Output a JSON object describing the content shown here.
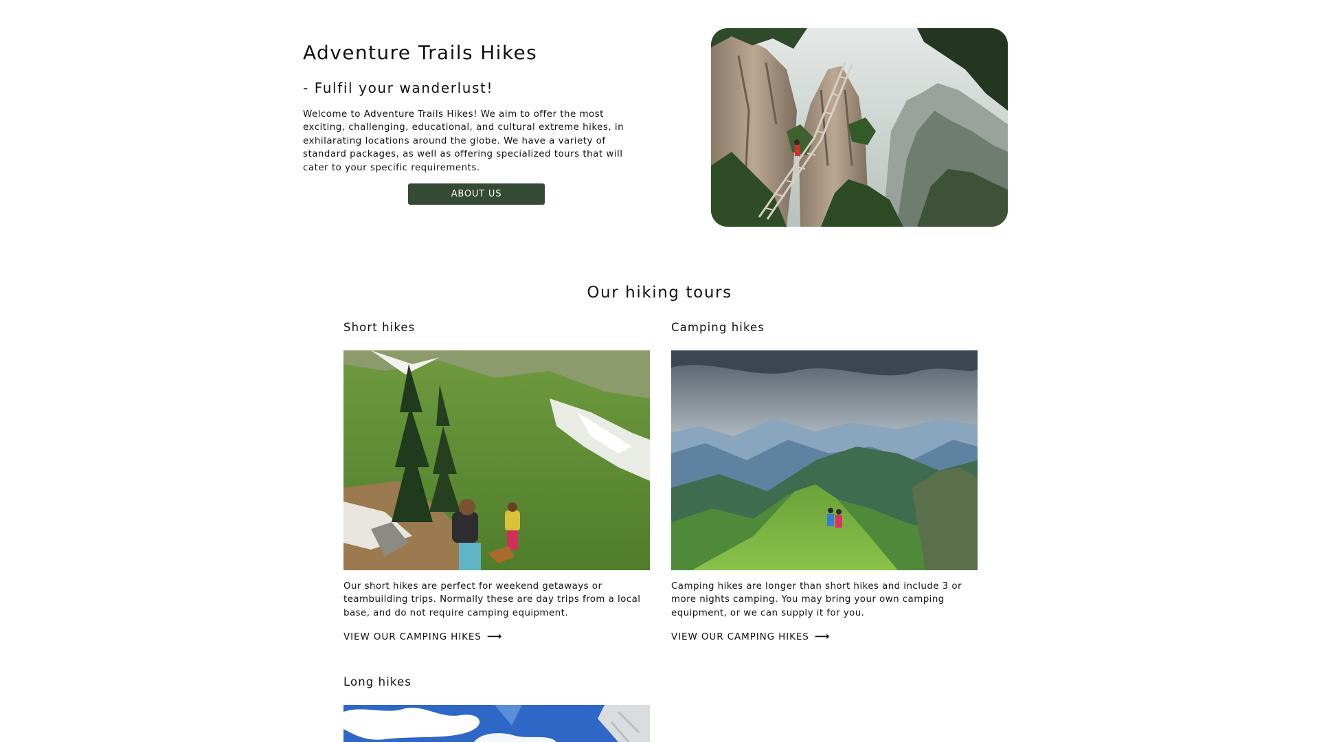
{
  "hero": {
    "title": "Adventure Trails Hikes",
    "subtitle": "- Fulfil your wanderlust!",
    "intro": "Welcome to Adventure Trails Hikes! We aim to offer the most exciting, challenging, educational, and cultural extreme hikes, in exhilarating locations around the globe. We have a variety of standard packages, as well as offering specialized tours that will cater to your specific requirements.",
    "about_button": "ABOUT US",
    "button_color": "#344a33"
  },
  "tours": {
    "heading": "Our hiking tours",
    "arrow_icon": "arrow-right-icon",
    "items": [
      {
        "title": "Short hikes",
        "description": "Our short hikes are perfect for weekend getaways or teambuilding trips. Normally these are day trips from a local base, and do not require camping equipment.",
        "link": "VIEW OUR CAMPING HIKES"
      },
      {
        "title": "Camping hikes",
        "description": "Camping hikes are longer than short hikes and include 3 or more nights camping. You may bring your own camping equipment, or we can supply it for you.",
        "link": "VIEW OUR CAMPING HIKES"
      },
      {
        "title": "Long hikes"
      }
    ]
  }
}
